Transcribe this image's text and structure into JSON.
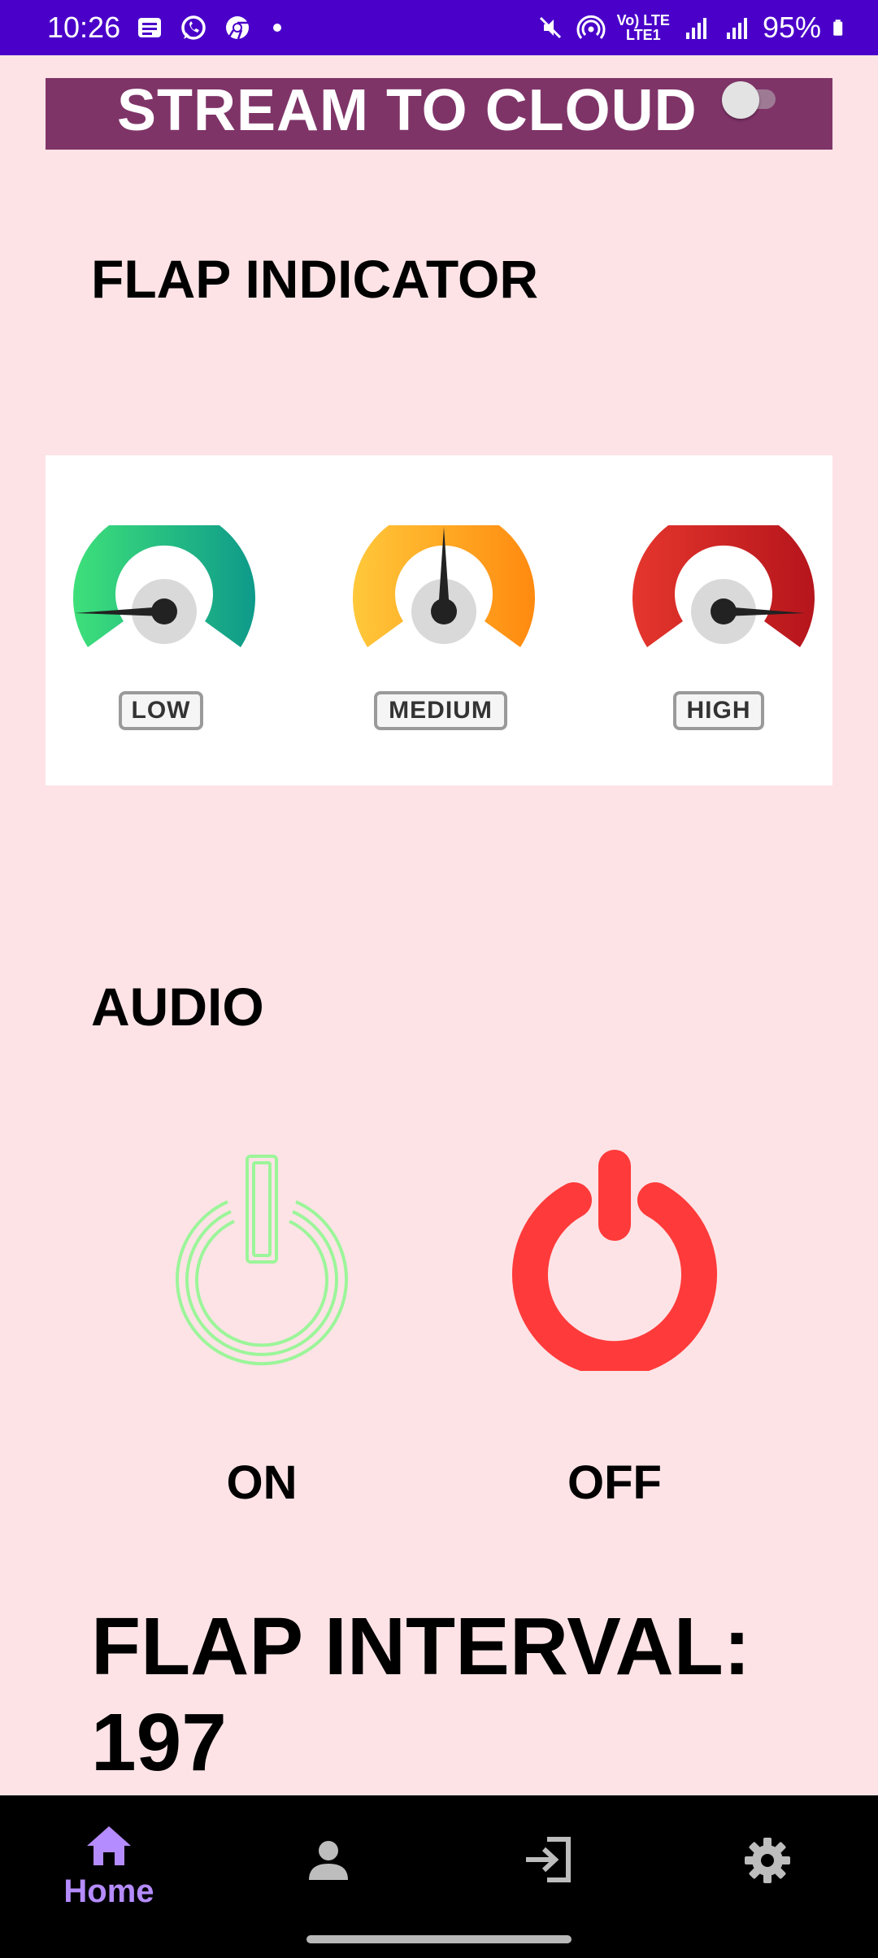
{
  "status_bar": {
    "time": "10:26",
    "network_top": "Vo) LTE",
    "network_bottom": "LTE1",
    "battery": "95%"
  },
  "stream": {
    "label": "STREAM TO CLOUD",
    "toggle_on": false
  },
  "flap_indicator": {
    "heading": "FLAP INDICATOR",
    "gauges": [
      {
        "label": "LOW",
        "color_start": "#3ee07a",
        "color_end": "#0e9a8a"
      },
      {
        "label": "MEDIUM",
        "color_start": "#ffc83a",
        "color_end": "#ff8a10"
      },
      {
        "label": "HIGH",
        "color_start": "#e5362d",
        "color_end": "#b5151c"
      }
    ]
  },
  "audio": {
    "heading": "AUDIO",
    "on_label": "ON",
    "off_label": "OFF",
    "on_color": "#9cf59a",
    "off_color": "#ff3a3a"
  },
  "flap_interval": {
    "text": "FLAP INTERVAL: 197"
  },
  "bottom_nav": {
    "items": [
      {
        "icon": "home-icon",
        "label": "Home",
        "active": true
      },
      {
        "icon": "person-icon",
        "label": ""
      },
      {
        "icon": "login-icon",
        "label": ""
      },
      {
        "icon": "gear-icon",
        "label": ""
      }
    ],
    "accent": "#b58cff"
  }
}
